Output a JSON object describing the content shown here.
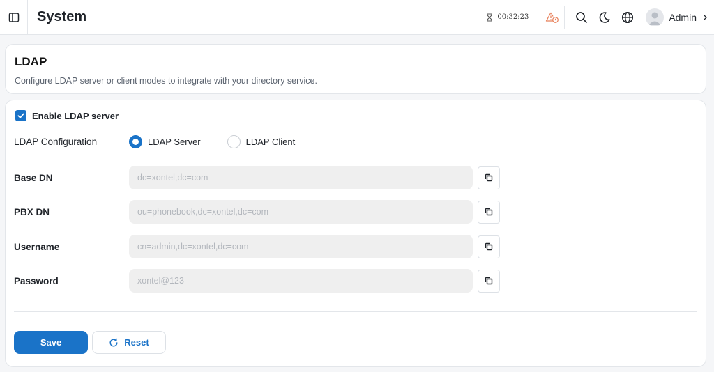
{
  "header": {
    "title": "System",
    "timer": "00:32:23",
    "user_name": "Admin",
    "accent_color": "#1a73c8",
    "alert_color": "#e8805a"
  },
  "ldap_info": {
    "title": "LDAP",
    "description": "Configure LDAP server or client modes to integrate with your directory service."
  },
  "form": {
    "enable_label": "Enable LDAP server",
    "enable_checked": true,
    "config_label": "LDAP Configuration",
    "config_options": [
      {
        "label": "LDAP Server",
        "selected": true
      },
      {
        "label": "LDAP Client",
        "selected": false
      }
    ],
    "fields": [
      {
        "label": "Base DN",
        "value": "dc=xontel,dc=com"
      },
      {
        "label": "PBX DN",
        "value": "ou=phonebook,dc=xontel,dc=com"
      },
      {
        "label": "Username",
        "value": "cn=admin,dc=xontel,dc=com"
      },
      {
        "label": "Password",
        "value": "xontel@123"
      }
    ],
    "save_label": "Save",
    "reset_label": "Reset"
  }
}
